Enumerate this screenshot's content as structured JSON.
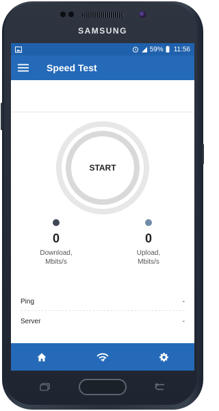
{
  "device": {
    "brand": "SAMSUNG"
  },
  "status_bar": {
    "icons": [
      "image-icon",
      "alarm-icon",
      "signal-icon",
      "battery-icon"
    ],
    "battery": "59%",
    "time": "11:56"
  },
  "app_bar": {
    "title": "Speed Test",
    "menu_icon": "hamburger-menu-icon"
  },
  "gauge": {
    "label": "START"
  },
  "metrics": {
    "download": {
      "value": "0",
      "label": "Download,",
      "unit": "Mbits/s",
      "color": "#3f4756"
    },
    "upload": {
      "value": "0",
      "label": "Upload,",
      "unit": "Mbits/s",
      "color": "#6f8ca8"
    }
  },
  "info_rows": [
    {
      "label": "Ping",
      "value": "-"
    },
    {
      "label": "Server",
      "value": "-"
    }
  ],
  "bottom_nav": {
    "items": [
      "home-icon",
      "wifi-icon",
      "settings-gear-icon"
    ]
  },
  "colors": {
    "primary": "#256ab8",
    "status_bar": "#1f61ac"
  }
}
